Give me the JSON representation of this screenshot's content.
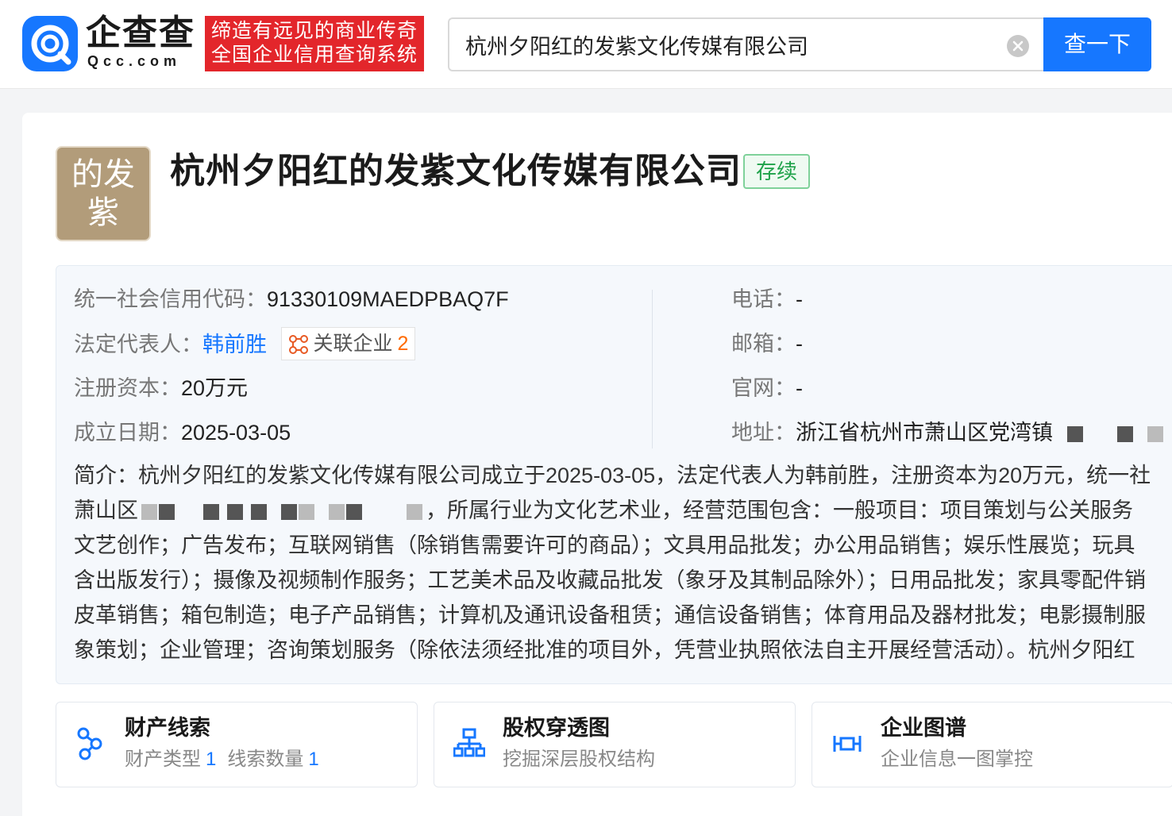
{
  "header": {
    "logo_cn": "企查查",
    "logo_en": "Qcc.com",
    "slogan_line1": "缔造有远见的商业传奇",
    "slogan_line2": "全国企业信用查询系统",
    "search_value": "杭州夕阳红的发紫文化传媒有限公司",
    "search_button": "查一下"
  },
  "company": {
    "avatar_line1": "的发",
    "avatar_line2": "紫",
    "name": "杭州夕阳红的发紫文化传媒有限公司",
    "status": "存续"
  },
  "info": {
    "credit_code_label": "统一社会信用代码：",
    "credit_code_value": "91330109MAEDPBAQ7F",
    "legal_rep_label": "法定代表人：",
    "legal_rep_value": "韩前胜",
    "related_label": "关联企业",
    "related_count": "2",
    "capital_label": "注册资本：",
    "capital_value": "20万元",
    "founded_label": "成立日期：",
    "founded_value": "2025-03-05",
    "phone_label": "电话：",
    "phone_value": "-",
    "email_label": "邮箱：",
    "email_value": "-",
    "website_label": "官网：",
    "website_value": "-",
    "address_label": "地址：",
    "address_value": "浙江省杭州市萧山区党湾镇"
  },
  "description": {
    "line1": "简介：杭州夕阳红的发紫文化传媒有限公司成立于2025-03-05，法定代表人为韩前胜，注册资本为20万元，统一社",
    "line2_prefix": "萧山区",
    "line2_suffix": "，所属行业为文化艺术业，经营范围包含：一般项目：项目策划与公关服务",
    "line3": "文艺创作；广告发布；互联网销售（除销售需要许可的商品）；文具用品批发；办公用品销售；娱乐性展览；玩具",
    "line4": "含出版发行）；摄像及视频制作服务；工艺美术品及收藏品批发（象牙及其制品除外）；日用品批发；家具零配件销",
    "line5": "皮革销售；箱包制造；电子产品销售；计算机及通讯设备租赁；通信设备销售；体育用品及器材批发；电影摄制服",
    "line6": "象策划；企业管理；咨询策划服务（除依法须经批准的项目外，凭营业执照依法自主开展经营活动）。杭州夕阳红"
  },
  "features": [
    {
      "title": "财产线索",
      "sub_label1": "财产类型",
      "sub_num1": "1",
      "sub_label2": "线索数量",
      "sub_num2": "1"
    },
    {
      "title": "股权穿透图",
      "subtitle": "挖掘深层股权结构"
    },
    {
      "title": "企业图谱",
      "subtitle": "企业信息一图掌控"
    }
  ],
  "colors": {
    "brand_blue": "#1677ff",
    "slogan_red": "#e3262b",
    "status_green": "#1fa24a",
    "avatar_tan": "#b29c7a",
    "count_orange": "#ff6a00"
  }
}
